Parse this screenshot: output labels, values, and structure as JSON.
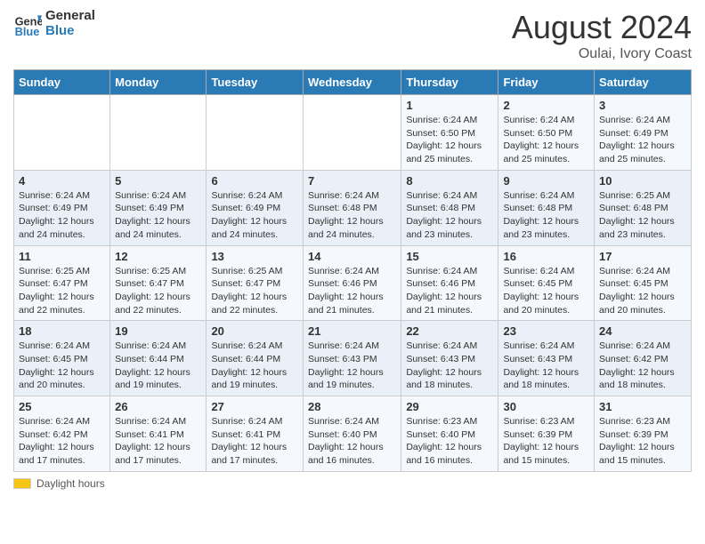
{
  "header": {
    "logo_line1": "General",
    "logo_line2": "Blue",
    "main_title": "August 2024",
    "subtitle": "Oulai, Ivory Coast"
  },
  "weekdays": [
    "Sunday",
    "Monday",
    "Tuesday",
    "Wednesday",
    "Thursday",
    "Friday",
    "Saturday"
  ],
  "footer": {
    "daylight_label": "Daylight hours"
  },
  "weeks": [
    [
      {
        "day": "",
        "info": ""
      },
      {
        "day": "",
        "info": ""
      },
      {
        "day": "",
        "info": ""
      },
      {
        "day": "",
        "info": ""
      },
      {
        "day": "1",
        "info": "Sunrise: 6:24 AM\nSunset: 6:50 PM\nDaylight: 12 hours and 25 minutes."
      },
      {
        "day": "2",
        "info": "Sunrise: 6:24 AM\nSunset: 6:50 PM\nDaylight: 12 hours and 25 minutes."
      },
      {
        "day": "3",
        "info": "Sunrise: 6:24 AM\nSunset: 6:49 PM\nDaylight: 12 hours and 25 minutes."
      }
    ],
    [
      {
        "day": "4",
        "info": "Sunrise: 6:24 AM\nSunset: 6:49 PM\nDaylight: 12 hours and 24 minutes."
      },
      {
        "day": "5",
        "info": "Sunrise: 6:24 AM\nSunset: 6:49 PM\nDaylight: 12 hours and 24 minutes."
      },
      {
        "day": "6",
        "info": "Sunrise: 6:24 AM\nSunset: 6:49 PM\nDaylight: 12 hours and 24 minutes."
      },
      {
        "day": "7",
        "info": "Sunrise: 6:24 AM\nSunset: 6:48 PM\nDaylight: 12 hours and 24 minutes."
      },
      {
        "day": "8",
        "info": "Sunrise: 6:24 AM\nSunset: 6:48 PM\nDaylight: 12 hours and 23 minutes."
      },
      {
        "day": "9",
        "info": "Sunrise: 6:24 AM\nSunset: 6:48 PM\nDaylight: 12 hours and 23 minutes."
      },
      {
        "day": "10",
        "info": "Sunrise: 6:25 AM\nSunset: 6:48 PM\nDaylight: 12 hours and 23 minutes."
      }
    ],
    [
      {
        "day": "11",
        "info": "Sunrise: 6:25 AM\nSunset: 6:47 PM\nDaylight: 12 hours and 22 minutes."
      },
      {
        "day": "12",
        "info": "Sunrise: 6:25 AM\nSunset: 6:47 PM\nDaylight: 12 hours and 22 minutes."
      },
      {
        "day": "13",
        "info": "Sunrise: 6:25 AM\nSunset: 6:47 PM\nDaylight: 12 hours and 22 minutes."
      },
      {
        "day": "14",
        "info": "Sunrise: 6:24 AM\nSunset: 6:46 PM\nDaylight: 12 hours and 21 minutes."
      },
      {
        "day": "15",
        "info": "Sunrise: 6:24 AM\nSunset: 6:46 PM\nDaylight: 12 hours and 21 minutes."
      },
      {
        "day": "16",
        "info": "Sunrise: 6:24 AM\nSunset: 6:45 PM\nDaylight: 12 hours and 20 minutes."
      },
      {
        "day": "17",
        "info": "Sunrise: 6:24 AM\nSunset: 6:45 PM\nDaylight: 12 hours and 20 minutes."
      }
    ],
    [
      {
        "day": "18",
        "info": "Sunrise: 6:24 AM\nSunset: 6:45 PM\nDaylight: 12 hours and 20 minutes."
      },
      {
        "day": "19",
        "info": "Sunrise: 6:24 AM\nSunset: 6:44 PM\nDaylight: 12 hours and 19 minutes."
      },
      {
        "day": "20",
        "info": "Sunrise: 6:24 AM\nSunset: 6:44 PM\nDaylight: 12 hours and 19 minutes."
      },
      {
        "day": "21",
        "info": "Sunrise: 6:24 AM\nSunset: 6:43 PM\nDaylight: 12 hours and 19 minutes."
      },
      {
        "day": "22",
        "info": "Sunrise: 6:24 AM\nSunset: 6:43 PM\nDaylight: 12 hours and 18 minutes."
      },
      {
        "day": "23",
        "info": "Sunrise: 6:24 AM\nSunset: 6:43 PM\nDaylight: 12 hours and 18 minutes."
      },
      {
        "day": "24",
        "info": "Sunrise: 6:24 AM\nSunset: 6:42 PM\nDaylight: 12 hours and 18 minutes."
      }
    ],
    [
      {
        "day": "25",
        "info": "Sunrise: 6:24 AM\nSunset: 6:42 PM\nDaylight: 12 hours and 17 minutes."
      },
      {
        "day": "26",
        "info": "Sunrise: 6:24 AM\nSunset: 6:41 PM\nDaylight: 12 hours and 17 minutes."
      },
      {
        "day": "27",
        "info": "Sunrise: 6:24 AM\nSunset: 6:41 PM\nDaylight: 12 hours and 17 minutes."
      },
      {
        "day": "28",
        "info": "Sunrise: 6:24 AM\nSunset: 6:40 PM\nDaylight: 12 hours and 16 minutes."
      },
      {
        "day": "29",
        "info": "Sunrise: 6:23 AM\nSunset: 6:40 PM\nDaylight: 12 hours and 16 minutes."
      },
      {
        "day": "30",
        "info": "Sunrise: 6:23 AM\nSunset: 6:39 PM\nDaylight: 12 hours and 15 minutes."
      },
      {
        "day": "31",
        "info": "Sunrise: 6:23 AM\nSunset: 6:39 PM\nDaylight: 12 hours and 15 minutes."
      }
    ]
  ]
}
